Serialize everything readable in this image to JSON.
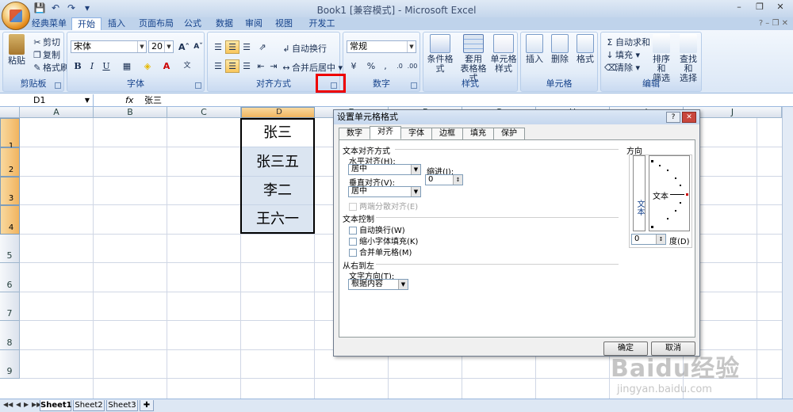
{
  "window": {
    "title": "Book1  [兼容模式] - Microsoft Excel"
  },
  "tabs": [
    "经典菜单",
    "开始",
    "插入",
    "页面布局",
    "公式",
    "数据",
    "审阅",
    "视图",
    "开发工具"
  ],
  "active_tab": "开始",
  "ribbon": {
    "clipboard": {
      "label": "剪贴板",
      "paste": "粘贴",
      "cut": "剪切",
      "copy": "复制",
      "format_painter": "格式刷"
    },
    "font": {
      "label": "字体",
      "font_name": "宋体",
      "font_size": "20",
      "bold": "B",
      "italic": "I",
      "underline": "U"
    },
    "alignment": {
      "label": "对齐方式",
      "wrap_text": "自动换行",
      "merge_center": "合并后居中"
    },
    "number": {
      "label": "数字",
      "format": "常规"
    },
    "styles": {
      "label": "样式",
      "conditional": "条件格式",
      "table_format_1": "套用",
      "table_format_2": "表格格式",
      "cell_style_1": "单元格",
      "cell_style_2": "样式"
    },
    "cells": {
      "label": "单元格",
      "insert": "插入",
      "delete": "删除",
      "format": "格式"
    },
    "editing": {
      "label": "编辑",
      "autosum": "自动求和",
      "fill": "填充",
      "clear": "清除",
      "sort_filter_1": "排序和",
      "sort_filter_2": "筛选",
      "find_select_1": "查找和",
      "find_select_2": "选择"
    }
  },
  "formula_bar": {
    "name_box": "D1",
    "fx": "fx",
    "value": "张三"
  },
  "columns": [
    "A",
    "B",
    "C",
    "D",
    "E",
    "F",
    "G",
    "H",
    "I",
    "J"
  ],
  "rows": [
    "1",
    "2",
    "3",
    "4",
    "5",
    "6",
    "7",
    "8",
    "9"
  ],
  "cells": [
    "张三",
    "张三五",
    "李二",
    "王六一"
  ],
  "sheets": [
    "Sheet1",
    "Sheet2",
    "Sheet3"
  ],
  "dialog": {
    "title": "设置单元格格式",
    "tabs": [
      "数字",
      "对齐",
      "字体",
      "边框",
      "填充",
      "保护"
    ],
    "active_tab": "对齐",
    "text_alignment": "文本对齐方式",
    "horizontal_label": "水平对齐(H):",
    "horizontal_value": "居中",
    "indent_label": "缩进(I):",
    "indent_value": "0",
    "vertical_label": "垂直对齐(V):",
    "vertical_value": "居中",
    "justify_distributed": "两端分散对齐(E)",
    "text_control": "文本控制",
    "wrap_text": "自动换行(W)",
    "shrink_to_fit": "缩小字体填充(K)",
    "merge_cells": "合并单元格(M)",
    "rtl": "从右到左",
    "text_direction_label": "文字方向(T):",
    "text_direction_value": "根据内容",
    "orientation": "方向",
    "vertical_text": "文本",
    "dial_text": "文本",
    "degrees_value": "0",
    "degrees_label": "度(D)",
    "ok": "确定",
    "cancel": "取消"
  },
  "watermark": {
    "brand": "Baidu经验",
    "url": "jingyan.baidu.com"
  }
}
